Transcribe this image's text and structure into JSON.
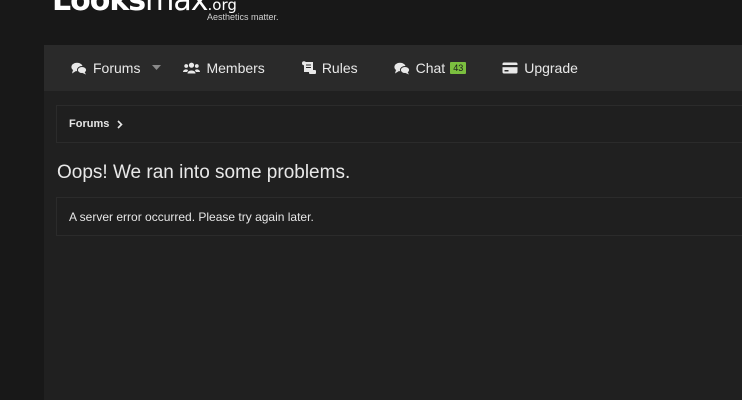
{
  "header": {
    "logo_main": "Looks",
    "logo_max": "max",
    "logo_org": ".org",
    "tagline": "Aesthetics matter."
  },
  "nav": {
    "forums": "Forums",
    "members": "Members",
    "rules": "Rules",
    "chat": "Chat",
    "chat_badge": "43",
    "upgrade": "Upgrade"
  },
  "breadcrumb": {
    "forums": "Forums"
  },
  "main": {
    "title": "Oops! We ran into some problems.",
    "error_message": "A server error occurred. Please try again later."
  },
  "colors": {
    "badge": "#7bbf3f",
    "navbar": "#2a2a2a",
    "content": "#202020",
    "background": "#181818"
  },
  "icons": {
    "forums": "comments-icon",
    "members": "users-icon",
    "rules": "scroll-icon",
    "chat": "comments-icon",
    "upgrade": "credit-card-icon"
  }
}
